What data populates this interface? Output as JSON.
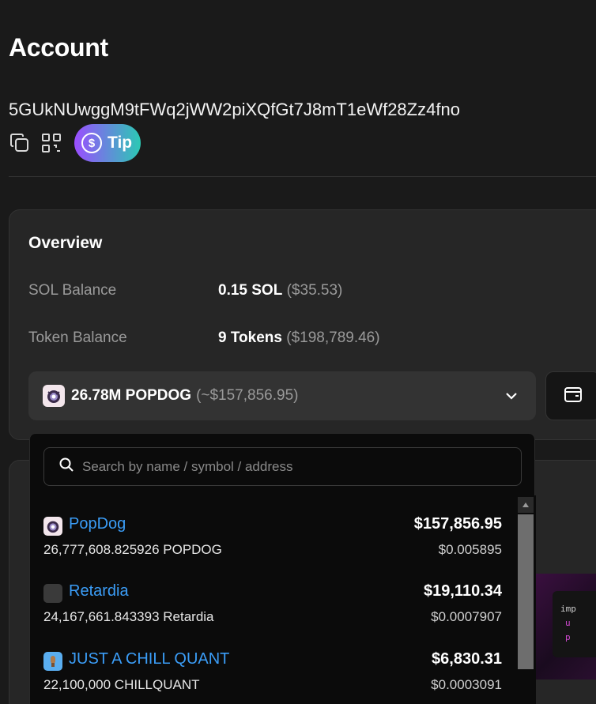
{
  "page": {
    "title": "Account"
  },
  "account": {
    "address": "5GUkNUwggM9tFWq2jWW2piXQfGt7J8mT1eWf28Zz4fno",
    "tip_label": "Tip",
    "tip_symbol": "$"
  },
  "overview": {
    "title": "Overview",
    "sol_balance": {
      "label": "SOL Balance",
      "value": "0.15 SOL",
      "usd": "($35.53)"
    },
    "token_balance": {
      "label": "Token Balance",
      "value": "9 Tokens",
      "usd": "($198,789.46)"
    },
    "selected_token": {
      "amount": "26.78M POPDOG",
      "usd": "(~$157,856.95)"
    }
  },
  "dropdown": {
    "search_placeholder": "Search by name / symbol / address",
    "items": [
      {
        "name": "PopDog",
        "amount": "26,777,608.825926 POPDOG",
        "usd": "$157,856.95",
        "price": "$0.005895",
        "icon": "popdog-icon"
      },
      {
        "name": "Retardia",
        "amount": "24,167,661.843393 Retardia",
        "usd": "$19,110.34",
        "price": "$0.0007907",
        "icon": "retardia-icon"
      },
      {
        "name": "JUST A CHILL QUANT",
        "amount": "22,100,000 CHILLQUANT",
        "usd": "$6,830.31",
        "price": "$0.0003091",
        "icon": "chillquant-icon"
      }
    ]
  },
  "preview": {
    "line1": "imp",
    "line2": "u",
    "line3": "p"
  },
  "colors": {
    "link": "#3b9df7",
    "background": "#1a1a1a",
    "card": "#262626",
    "tip_gradient_start": "#9b4dff",
    "tip_gradient_end": "#2bc9b4"
  }
}
